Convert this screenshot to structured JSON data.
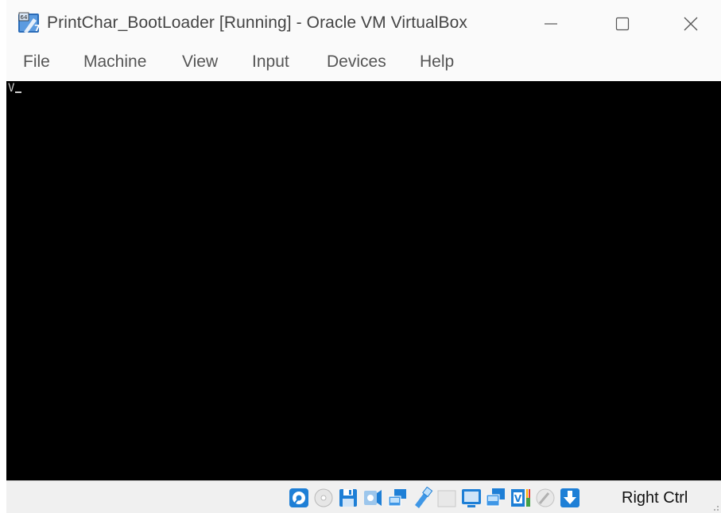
{
  "window": {
    "title": "PrintChar_BootLoader [Running] - Oracle VM VirtualBox"
  },
  "menu": {
    "items": [
      "File",
      "Machine",
      "View",
      "Input",
      "Devices",
      "Help"
    ]
  },
  "vm_screen": {
    "output_text": "V"
  },
  "statusbar": {
    "host_key": "Right Ctrl",
    "icons": [
      "hard-disk-icon",
      "optical-drive-icon",
      "floppy-icon",
      "audio-icon",
      "network-icon",
      "usb-icon",
      "shared-folders-icon",
      "display-icon",
      "recording-icon",
      "vt-x-icon",
      "mouse-integration-icon",
      "host-key-icon"
    ]
  },
  "colors": {
    "titlebar_bg": "#fafafa",
    "vm_bg": "#000000",
    "statusbar_bg": "#f0f0f0",
    "accent_blue": "#1e7fd6"
  }
}
